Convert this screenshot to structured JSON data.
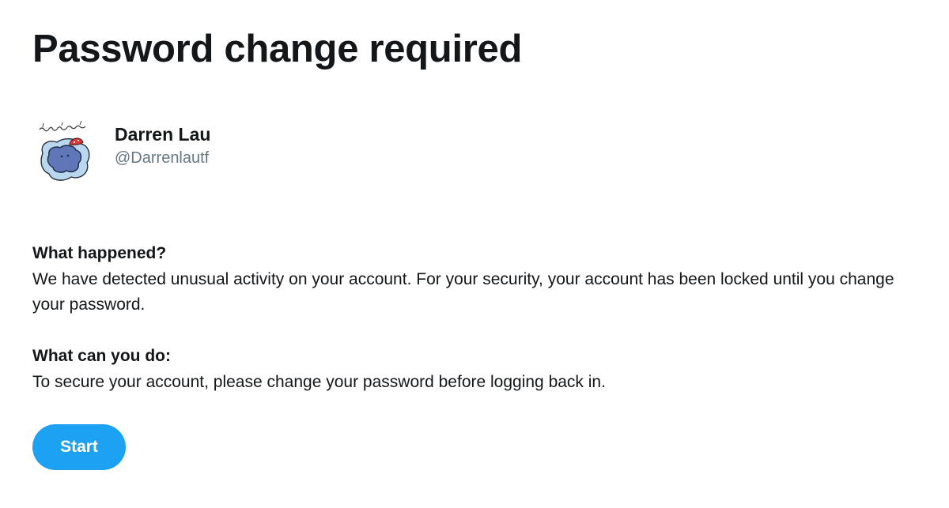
{
  "page": {
    "title": "Password change required"
  },
  "account": {
    "display_name": "Darren Lau",
    "handle": "@Darrenlautf",
    "avatar_icon": "hand-drawn-blob-avatar"
  },
  "sections": [
    {
      "heading": "What happened?",
      "body": "We have detected unusual activity on your account. For your security, your account has been locked until you change your password."
    },
    {
      "heading": "What can you do:",
      "body": "To secure your account, please change your password before logging back in."
    }
  ],
  "actions": {
    "start_label": "Start"
  },
  "colors": {
    "accent": "#1da1f2",
    "text_primary": "#14171a",
    "text_secondary": "#657786"
  }
}
